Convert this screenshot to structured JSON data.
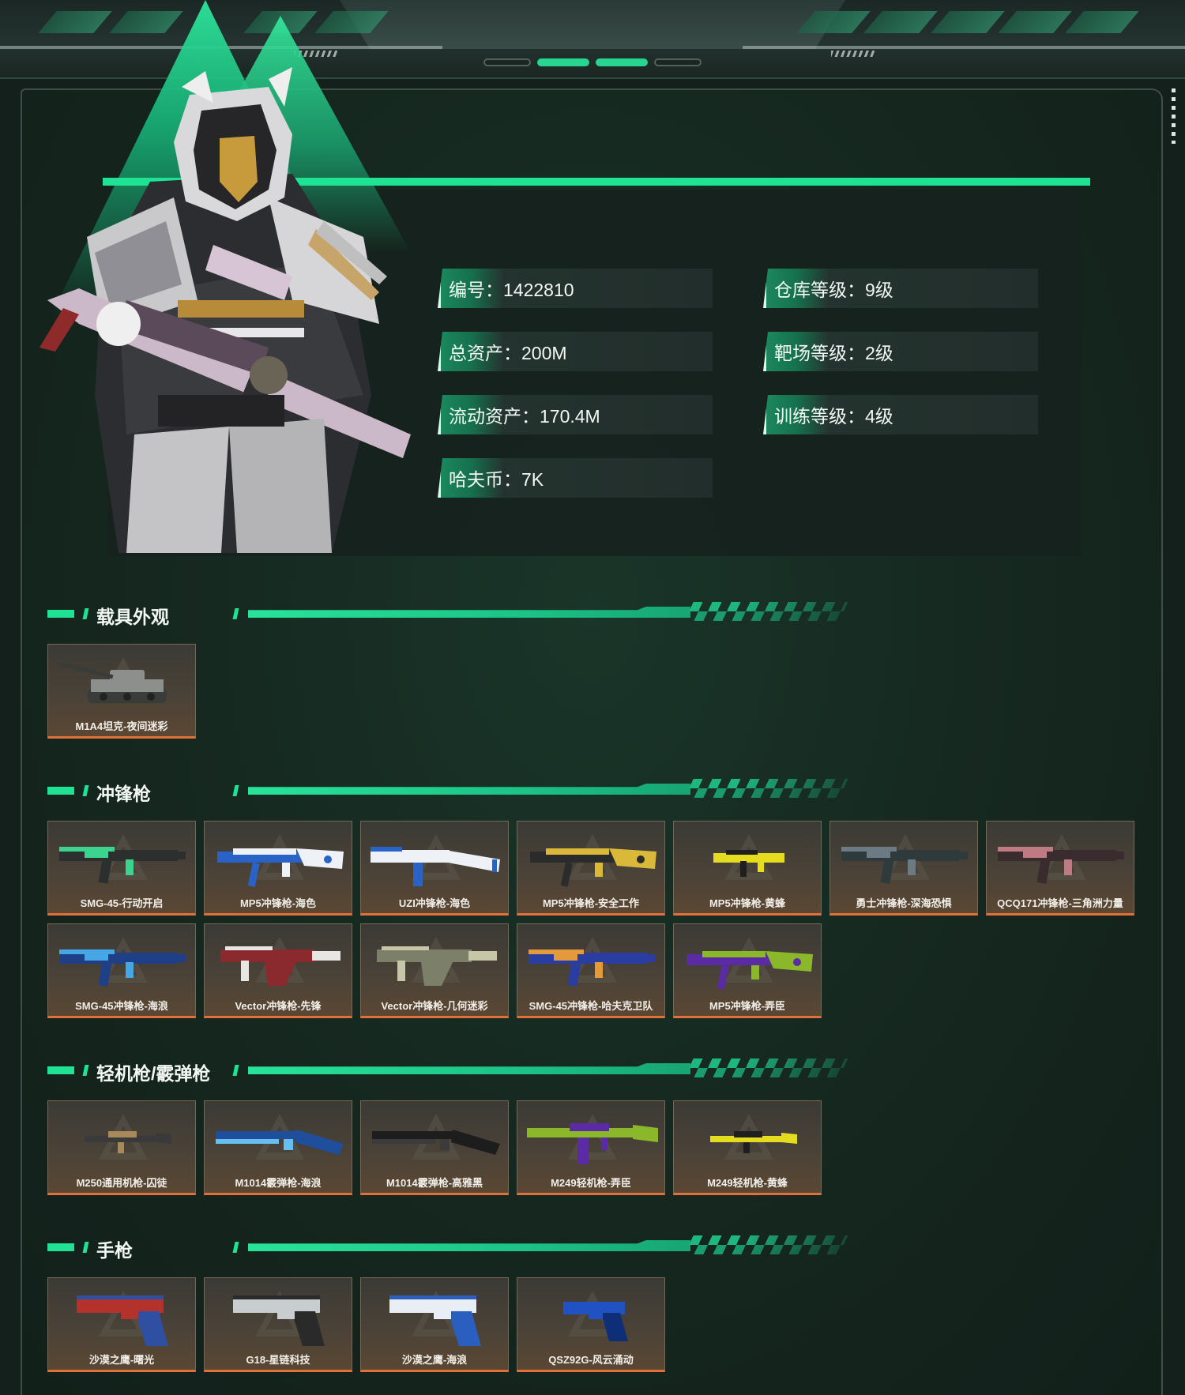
{
  "stats": {
    "id": "编号：1422810",
    "total_assets": "总资产：200M",
    "liquid_assets": "流动资产：170.4M",
    "hafu_coin": "哈夫币：7K",
    "warehouse_level": "仓库等级：9级",
    "range_level": "靶场等级：2级",
    "training_level": "训练等级：4级"
  },
  "colors": {
    "accent": "#1fe294",
    "card_bottom": "#e0713a",
    "panel_bg": "#15271f"
  },
  "sections": [
    {
      "title": "载具外观",
      "items": [
        {
          "label": "M1A4坦克-夜间迷彩",
          "icon": "tank",
          "c1": "#8d8f8c",
          "c2": "#3a3c3a"
        }
      ]
    },
    {
      "title": "冲锋枪",
      "items": [
        {
          "label": "SMG-45-行动开启",
          "icon": "smg",
          "c1": "#2b2f2e",
          "c2": "#3bd38d"
        },
        {
          "label": "MP5冲锋枪-海色",
          "icon": "mp5",
          "c1": "#eef2f6",
          "c2": "#2a63c7"
        },
        {
          "label": "UZI冲锋枪-海色",
          "icon": "uzi",
          "c1": "#eef2f6",
          "c2": "#2a63c7"
        },
        {
          "label": "MP5冲锋枪-安全工作",
          "icon": "mp5",
          "c1": "#d9b83a",
          "c2": "#2b2b2b"
        },
        {
          "label": "MP5冲锋枪-黄蜂",
          "icon": "smg-small",
          "c1": "#e6dc1f",
          "c2": "#1f1f1f"
        },
        {
          "label": "勇士冲锋枪-深海恐惧",
          "icon": "smg",
          "c1": "#2f3a3d",
          "c2": "#6c7b83"
        },
        {
          "label": "QCQ171冲锋枪-三角洲力量",
          "icon": "smg",
          "c1": "#3a2b2e",
          "c2": "#c07a84"
        },
        {
          "label": "SMG-45冲锋枪-海浪",
          "icon": "smg",
          "c1": "#1f3f86",
          "c2": "#46a7e6"
        },
        {
          "label": "Vector冲锋枪-先锋",
          "icon": "vector",
          "c1": "#8a2a2f",
          "c2": "#e8e6e3"
        },
        {
          "label": "Vector冲锋枪-几何迷彩",
          "icon": "vector",
          "c1": "#7c8068",
          "c2": "#c6c7a9"
        },
        {
          "label": "SMG-45冲锋枪-哈夫克卫队",
          "icon": "smg",
          "c1": "#2a3da0",
          "c2": "#e49a3c"
        },
        {
          "label": "MP5冲锋枪-弄臣",
          "icon": "mp5",
          "c1": "#8ab82a",
          "c2": "#5b2aa5"
        }
      ]
    },
    {
      "title": "轻机枪/霰弹枪",
      "items": [
        {
          "label": "M250通用机枪-囚徒",
          "icon": "lmg-small",
          "c1": "#3a3a3a",
          "c2": "#a88a5a"
        },
        {
          "label": "M1014霰弹枪-海浪",
          "icon": "shotgun",
          "c1": "#1f4f9c",
          "c2": "#66c0ef"
        },
        {
          "label": "M1014霰弹枪-高雅黑",
          "icon": "shotgun",
          "c1": "#1d1d1d",
          "c2": "#3b3b3b"
        },
        {
          "label": "M249轻机枪-弄臣",
          "icon": "lmg",
          "c1": "#8ab82a",
          "c2": "#5b2aa5"
        },
        {
          "label": "M249轻机枪-黄蜂",
          "icon": "lmg-small",
          "c1": "#e6dc1f",
          "c2": "#1f1f1f"
        }
      ]
    },
    {
      "title": "手枪",
      "items": [
        {
          "label": "沙漠之鹰-曙光",
          "icon": "pistol",
          "c1": "#b3322c",
          "c2": "#2f4fa3"
        },
        {
          "label": "G18-星链科技",
          "icon": "pistol",
          "c1": "#c8cdd0",
          "c2": "#2a2a2a"
        },
        {
          "label": "沙漠之鹰-海浪",
          "icon": "pistol",
          "c1": "#e8eef3",
          "c2": "#2a5fc0"
        },
        {
          "label": "QSZ92G-风云涌动",
          "icon": "pistol-small",
          "c1": "#2152c4",
          "c2": "#0f2e78"
        }
      ]
    }
  ]
}
